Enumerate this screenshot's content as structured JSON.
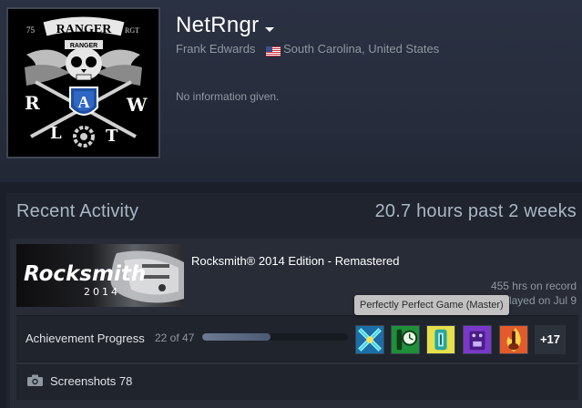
{
  "profile": {
    "persona_name": "NetRngr",
    "real_name": "Frank Edwards",
    "location": "South Carolina, United States",
    "summary": "No information given.",
    "avatar_text": {
      "ranger_top": "RANGER",
      "ranger_tab": "RANGER",
      "corner_left": "75",
      "corner_right": "RGT",
      "letters": [
        "R",
        "A",
        "W",
        "L",
        "T"
      ]
    }
  },
  "activity": {
    "title": "Recent Activity",
    "hours_summary": "20.7 hours past 2 weeks"
  },
  "game": {
    "name": "Rocksmith® 2014 Edition - Remastered",
    "capsule_title": "Rocksmith",
    "capsule_year": "2014",
    "hrs_on_record": "455 hrs on record",
    "last_played": "last played on Jul 9"
  },
  "achievements": {
    "label": "Achievement Progress",
    "count": "22 of 47",
    "progress": 0.468,
    "tooltip": "Perfectly Perfect Game (Master)",
    "more": "+17",
    "icons": [
      "crossed-arrows",
      "clock-guitar",
      "bass-tuner",
      "effects-pedal",
      "flaming-guitar"
    ]
  },
  "screenshots": {
    "label": "Screenshots 78"
  },
  "colors": {
    "background": "#1b1f29",
    "header": "#2a3142",
    "panel": "#20242e",
    "tooltip_bg": "#c2c2c2",
    "progress_fill": "#6c7a92"
  }
}
